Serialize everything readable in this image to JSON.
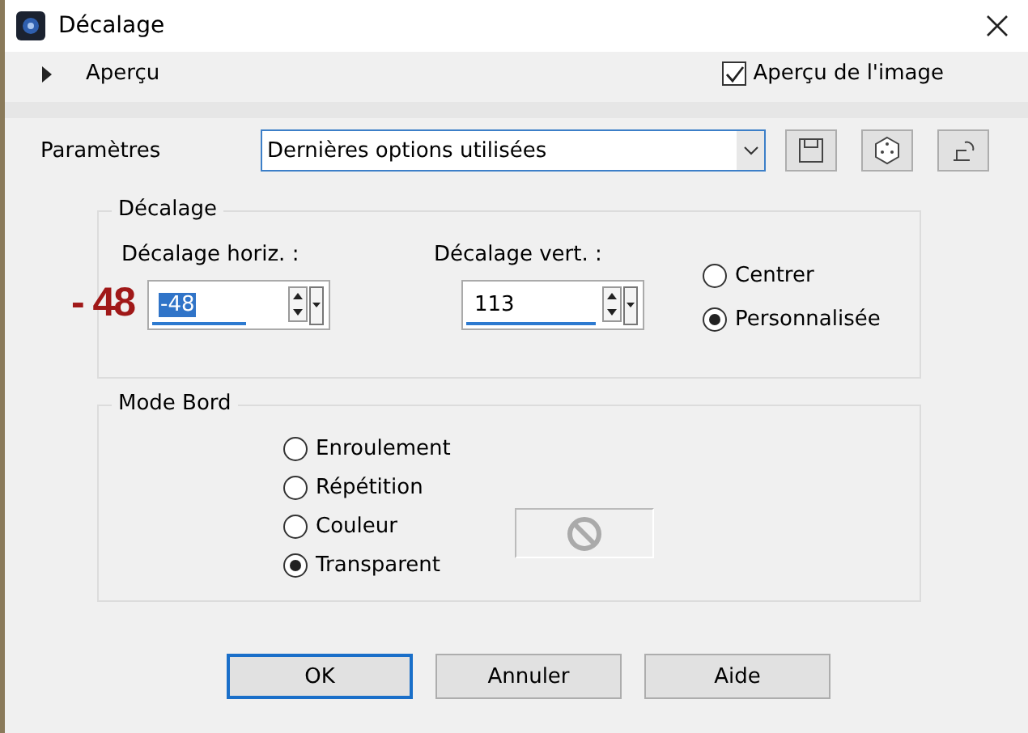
{
  "window": {
    "title": "Décalage"
  },
  "preview": {
    "label": "Aperçu",
    "expanded": false
  },
  "image_preview": {
    "label": "Aperçu de l'image",
    "checked": true
  },
  "settings": {
    "label": "Paramètres",
    "value": "Dernières options utilisées"
  },
  "offset_group": {
    "title": "Décalage",
    "fields": [
      {
        "label": "Décalage horiz. :",
        "value": "-48",
        "text_selected": true
      },
      {
        "label": "Décalage vert. :",
        "value": "113",
        "text_selected": false
      }
    ],
    "options": [
      {
        "label": "Centrer",
        "selected": false
      },
      {
        "label": "Personnalisée",
        "selected": true
      }
    ]
  },
  "annotation": "- 48",
  "edge_group": {
    "title": "Mode Bord",
    "options": [
      {
        "label": "Enroulement",
        "selected": false
      },
      {
        "label": "Répétition",
        "selected": false
      },
      {
        "label": "Couleur",
        "selected": false
      },
      {
        "label": "Transparent",
        "selected": true
      }
    ]
  },
  "buttons": [
    {
      "label": "OK",
      "default": true
    },
    {
      "label": "Annuler",
      "default": false
    },
    {
      "label": "Aide",
      "default": false
    }
  ]
}
